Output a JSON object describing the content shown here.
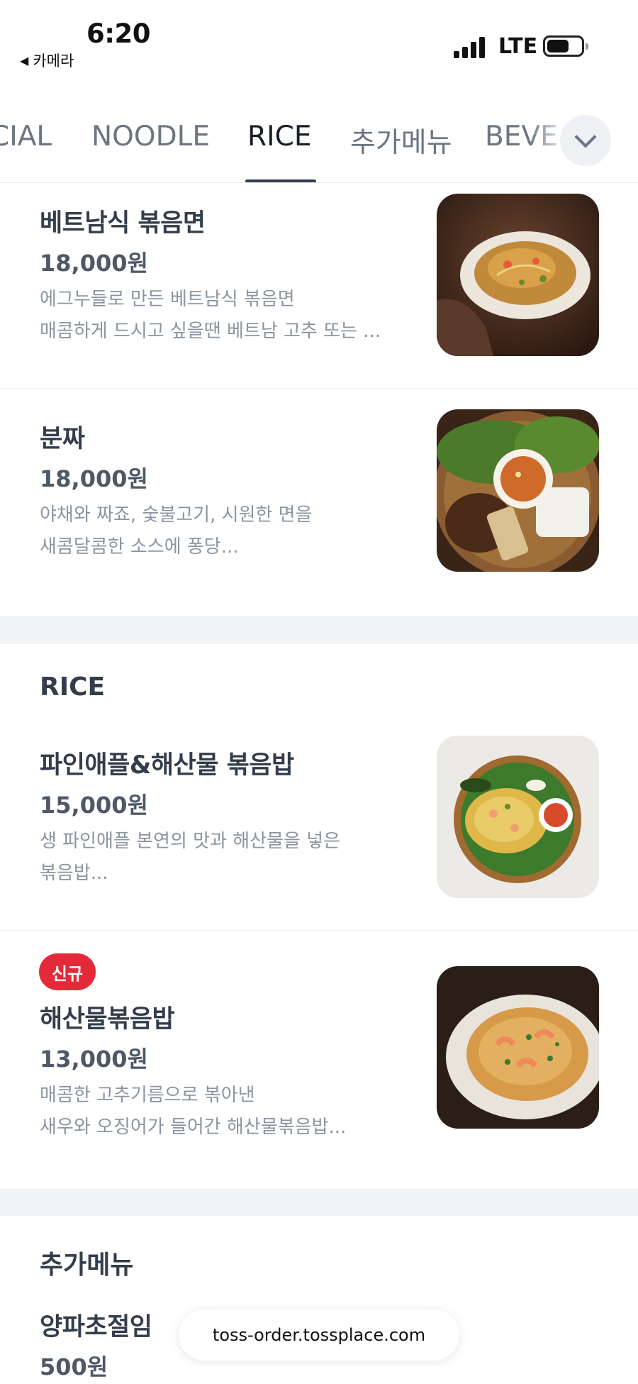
{
  "status_bar": {
    "time": "6:20",
    "back_app": "카메라",
    "network": "LTE"
  },
  "tabs": {
    "items": [
      "CIAL",
      "NOODLE",
      "RICE",
      "추가메뉴",
      "BEVE"
    ],
    "active": "RICE"
  },
  "items": {
    "pad_thai": {
      "name": "베트남식 볶음면",
      "price": "18,000원",
      "desc1": "에그누들로 만든 베트남식 볶음면",
      "desc2": "매콤하게 드시고 싶을땐 베트남 고추 또는 ..."
    },
    "bun_cha": {
      "name": "분짜",
      "price": "18,000원",
      "desc1": "야채와 짜죠, 숯불고기, 시원한 면을",
      "desc2": "새콤달콤한 소스에 퐁당..."
    },
    "pineapple_rice": {
      "name": "파인애플&해산물 볶음밥",
      "price": "15,000원",
      "desc1": "생 파인애플 본연의 맛과 해산물을 넣은",
      "desc2": "볶음밥..."
    },
    "seafood_rice": {
      "badge": "신규",
      "name": "해산물볶음밥",
      "price": "13,000원",
      "desc1": "매콤한 고추기름으로 볶아낸",
      "desc2": "새우와 오징어가 들어간 해산물볶음밥..."
    },
    "onion_pickle": {
      "name": "양파초절임",
      "price": "500원"
    }
  },
  "sections": {
    "rice": "RICE",
    "extra": "추가메뉴"
  },
  "url_bar": {
    "url": "toss-order.tossplace.com"
  }
}
